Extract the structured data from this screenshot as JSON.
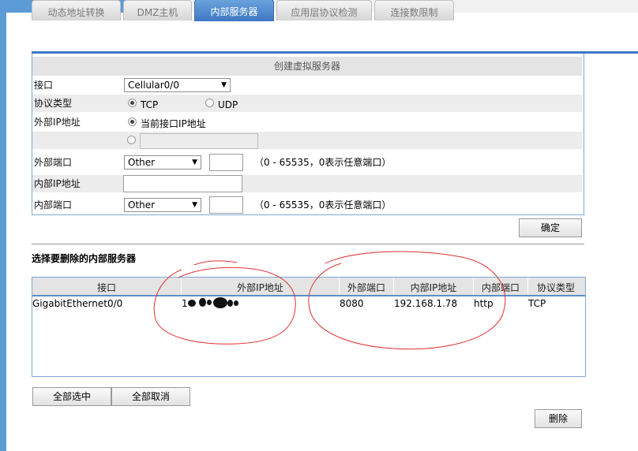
{
  "tabs": [
    {
      "label": "动态地址转换",
      "active": false
    },
    {
      "label": "DMZ主机",
      "active": false
    },
    {
      "label": "内部服务器",
      "active": true
    },
    {
      "label": "应用层协议检测",
      "active": false
    },
    {
      "label": "连接数限制",
      "active": false
    }
  ],
  "form": {
    "title": "创建虚拟服务器",
    "interface_label": "接口",
    "interface_value": "Cellular0/0",
    "protocol_label": "协议类型",
    "protocol_tcp": "TCP",
    "protocol_udp": "UDP",
    "protocol_selected": "TCP",
    "ext_ip_label": "外部IP地址",
    "ext_ip_option_current": "当前接口IP地址",
    "ext_ip_custom_value": "",
    "ext_port_label": "外部端口",
    "ext_port_select": "Other",
    "ext_port_value": "",
    "port_hint": "（0 - 65535，0表示任意端口）",
    "int_ip_label": "内部IP地址",
    "int_ip_value": "",
    "int_port_label": "内部端口",
    "int_port_select": "Other",
    "int_port_value": "",
    "confirm_button": "确定"
  },
  "delete_section": {
    "title": "选择要删除的内部服务器",
    "columns": [
      "接口",
      "外部IP地址",
      "外部端口",
      "内部IP地址",
      "内部端口",
      "协议类型"
    ],
    "rows": [
      {
        "interface": "GigabitEthernet0/0",
        "ext_ip": "1",
        "ext_port": "8080",
        "int_ip": "192.168.1.78",
        "int_port": "http",
        "protocol": "TCP"
      }
    ],
    "select_all_button": "全部选中",
    "deselect_all_button": "全部取消",
    "delete_button": "删除"
  },
  "colors": {
    "accent": "#3e78c4",
    "annotation": "#e03030"
  }
}
